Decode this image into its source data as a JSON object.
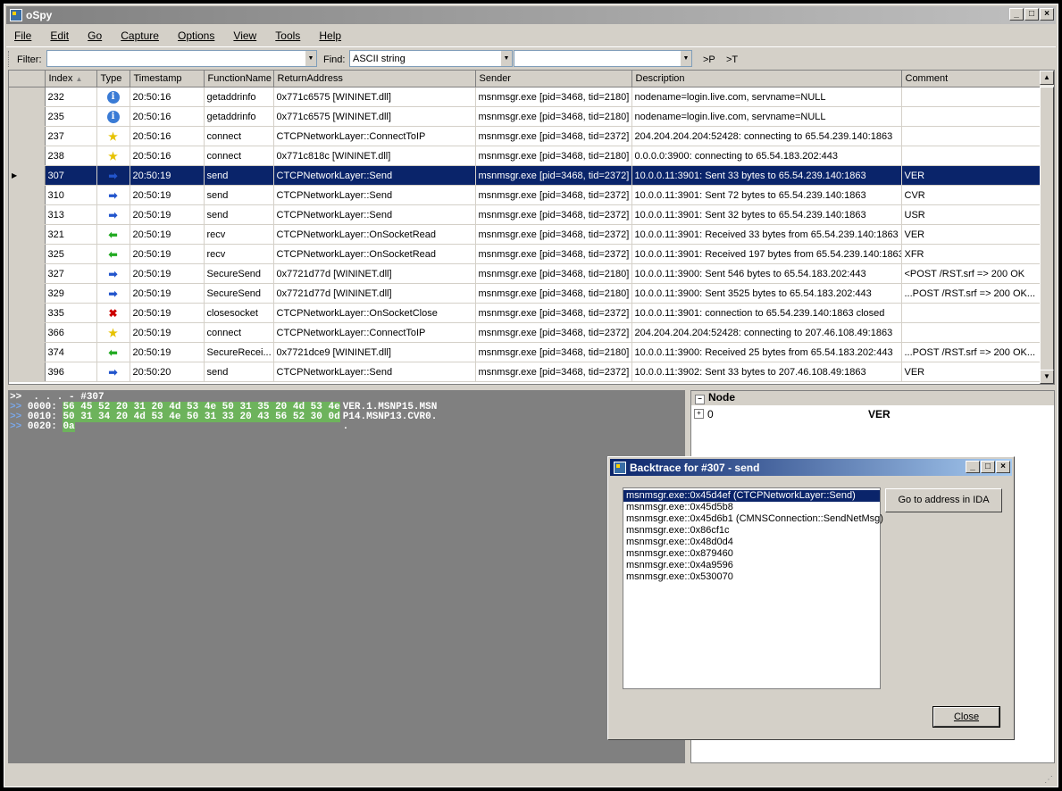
{
  "app": {
    "title": "oSpy"
  },
  "menu": [
    "File",
    "Edit",
    "Go",
    "Capture",
    "Options",
    "View",
    "Tools",
    "Help"
  ],
  "toolbar": {
    "filter_label": "Filter:",
    "filter_value": "",
    "find_label": "Find:",
    "find_type": "ASCII string",
    "find_value": "",
    "prev_label": ">P",
    "next_label": ">T"
  },
  "grid": {
    "columns": [
      "Index",
      "Type",
      "Timestamp",
      "FunctionName",
      "ReturnAddress",
      "Sender",
      "Description",
      "Comment"
    ],
    "rows": [
      {
        "index": "232",
        "type": "info-icon",
        "ts": "20:50:16",
        "fn": "getaddrinfo",
        "ret": "0x771c6575 [WININET.dll]",
        "sender": "msnmsgr.exe [pid=3468, tid=2180]",
        "desc": "nodename=login.live.com, servname=NULL",
        "comment": ""
      },
      {
        "index": "235",
        "type": "info-icon",
        "ts": "20:50:16",
        "fn": "getaddrinfo",
        "ret": "0x771c6575 [WININET.dll]",
        "sender": "msnmsgr.exe [pid=3468, tid=2180]",
        "desc": "nodename=login.live.com, servname=NULL",
        "comment": ""
      },
      {
        "index": "237",
        "type": "star-icon",
        "ts": "20:50:16",
        "fn": "connect",
        "ret": "CTCPNetworkLayer::ConnectToIP",
        "sender": "msnmsgr.exe [pid=3468, tid=2372]",
        "desc": "204.204.204.204:52428: connecting to 65.54.239.140:1863",
        "comment": ""
      },
      {
        "index": "238",
        "type": "star-icon",
        "ts": "20:50:16",
        "fn": "connect",
        "ret": "0x771c818c [WININET.dll]",
        "sender": "msnmsgr.exe [pid=3468, tid=2180]",
        "desc": "0.0.0.0:3900: connecting to 65.54.183.202:443",
        "comment": ""
      },
      {
        "index": "307",
        "type": "send-arrow-icon",
        "ts": "20:50:19",
        "fn": "send",
        "ret": "CTCPNetworkLayer::Send",
        "sender": "msnmsgr.exe [pid=3468, tid=2372]",
        "desc": "10.0.0.11:3901: Sent 33 bytes to 65.54.239.140:1863",
        "comment": "VER",
        "selected": true
      },
      {
        "index": "310",
        "type": "send-arrow-icon",
        "ts": "20:50:19",
        "fn": "send",
        "ret": "CTCPNetworkLayer::Send",
        "sender": "msnmsgr.exe [pid=3468, tid=2372]",
        "desc": "10.0.0.11:3901: Sent 72 bytes to 65.54.239.140:1863",
        "comment": "CVR"
      },
      {
        "index": "313",
        "type": "send-arrow-icon",
        "ts": "20:50:19",
        "fn": "send",
        "ret": "CTCPNetworkLayer::Send",
        "sender": "msnmsgr.exe [pid=3468, tid=2372]",
        "desc": "10.0.0.11:3901: Sent 32 bytes to 65.54.239.140:1863",
        "comment": "USR"
      },
      {
        "index": "321",
        "type": "recv-arrow-icon",
        "ts": "20:50:19",
        "fn": "recv",
        "ret": "CTCPNetworkLayer::OnSocketRead",
        "sender": "msnmsgr.exe [pid=3468, tid=2372]",
        "desc": "10.0.0.11:3901: Received 33 bytes from 65.54.239.140:1863",
        "comment": "VER"
      },
      {
        "index": "325",
        "type": "recv-arrow-icon",
        "ts": "20:50:19",
        "fn": "recv",
        "ret": "CTCPNetworkLayer::OnSocketRead",
        "sender": "msnmsgr.exe [pid=3468, tid=2372]",
        "desc": "10.0.0.11:3901: Received 197 bytes from 65.54.239.140:1863",
        "comment": "XFR"
      },
      {
        "index": "327",
        "type": "send-arrow-icon",
        "ts": "20:50:19",
        "fn": "SecureSend",
        "ret": "0x7721d77d [WININET.dll]",
        "sender": "msnmsgr.exe [pid=3468, tid=2180]",
        "desc": "10.0.0.11:3900: Sent 546 bytes to 65.54.183.202:443",
        "comment": "<POST /RST.srf => 200 OK"
      },
      {
        "index": "329",
        "type": "send-arrow-icon",
        "ts": "20:50:19",
        "fn": "SecureSend",
        "ret": "0x7721d77d [WININET.dll]",
        "sender": "msnmsgr.exe [pid=3468, tid=2180]",
        "desc": "10.0.0.11:3900: Sent 3525 bytes to 65.54.183.202:443",
        "comment": "...POST /RST.srf => 200 OK..."
      },
      {
        "index": "335",
        "type": "close-socket-icon",
        "ts": "20:50:19",
        "fn": "closesocket",
        "ret": "CTCPNetworkLayer::OnSocketClose",
        "sender": "msnmsgr.exe [pid=3468, tid=2372]",
        "desc": "10.0.0.11:3901: connection to 65.54.239.140:1863 closed",
        "comment": ""
      },
      {
        "index": "366",
        "type": "star-icon",
        "ts": "20:50:19",
        "fn": "connect",
        "ret": "CTCPNetworkLayer::ConnectToIP",
        "sender": "msnmsgr.exe [pid=3468, tid=2372]",
        "desc": "204.204.204.204:52428: connecting to 207.46.108.49:1863",
        "comment": ""
      },
      {
        "index": "374",
        "type": "recv-arrow-icon",
        "ts": "20:50:19",
        "fn": "SecureRecei...",
        "ret": "0x7721dce9 [WININET.dll]",
        "sender": "msnmsgr.exe [pid=3468, tid=2180]",
        "desc": "10.0.0.11:3900: Received 25 bytes from 65.54.183.202:443",
        "comment": "...POST /RST.srf => 200 OK..."
      },
      {
        "index": "396",
        "type": "send-arrow-icon",
        "ts": "20:50:20",
        "fn": "send",
        "ret": "CTCPNetworkLayer::Send",
        "sender": "msnmsgr.exe [pid=3468, tid=2372]",
        "desc": "10.0.0.11:3902: Sent 33 bytes to 207.46.108.49:1863",
        "comment": "VER"
      }
    ]
  },
  "hex": {
    "header": ">>  . . . - #307",
    "lines": [
      {
        "prompt": ">>",
        "offset": "0000:",
        "bytes": "56 45 52 20 31 20 4d 53 4e 50 31 35 20 4d 53 4e",
        "ascii": "VER.1.MSNP15.MSN"
      },
      {
        "prompt": ">>",
        "offset": "0010:",
        "bytes": "50 31 34 20 4d 53 4e 50 31 33 20 43 56 52 30 0d",
        "ascii": "P14.MSNP13.CVR0."
      },
      {
        "prompt": ">>",
        "offset": "0020:",
        "bytes": "0a",
        "ascii": "."
      }
    ]
  },
  "node": {
    "header": "Node",
    "rows": [
      {
        "key": "0",
        "value": "VER"
      }
    ]
  },
  "backtrace": {
    "title": "Backtrace for #307 - send",
    "items": [
      "msnmsgr.exe::0x45d4ef (CTCPNetworkLayer::Send)",
      "msnmsgr.exe::0x45d5b8",
      "msnmsgr.exe::0x45d6b1 (CMNSConnection::SendNetMsg)",
      "msnmsgr.exe::0x86cf1c",
      "msnmsgr.exe::0x48d0d4",
      "msnmsgr.exe::0x879460",
      "msnmsgr.exe::0x4a9596",
      "msnmsgr.exe::0x530070"
    ],
    "goto_label": "Go to address in IDA",
    "close_label": "Close"
  }
}
